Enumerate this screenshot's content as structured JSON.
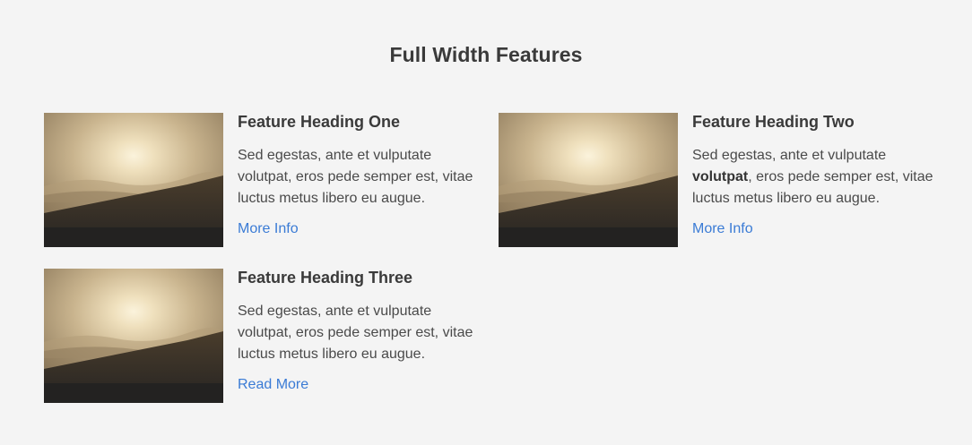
{
  "section": {
    "title": "Full Width Features"
  },
  "colors": {
    "background": "#f4f4f4",
    "heading": "#3a3a3a",
    "text": "#4a4a4a",
    "link": "#3a7bd5"
  },
  "features": [
    {
      "heading": "Feature Heading One",
      "text_before": "Sed egestas, ante et vulputate ",
      "text_bold": "",
      "text_after": "volutpat, eros pede semper est, vitae luctus metus libero eu augue.",
      "link": "More Info",
      "image": "misty-mountain-sunrise-photo"
    },
    {
      "heading": "Feature Heading Two",
      "text_before": "Sed egestas, ante et vulputate ",
      "text_bold": "volutpat",
      "text_after": ", eros pede semper est, vitae luctus metus libero eu augue.",
      "link": "More Info",
      "image": "misty-mountain-sunrise-photo"
    },
    {
      "heading": "Feature Heading Three",
      "text_before": "Sed egestas, ante et vulputate ",
      "text_bold": "",
      "text_after": "volutpat, eros pede semper est, vitae luctus metus libero eu augue.",
      "link": "Read More",
      "image": "misty-mountain-sunrise-photo"
    }
  ]
}
